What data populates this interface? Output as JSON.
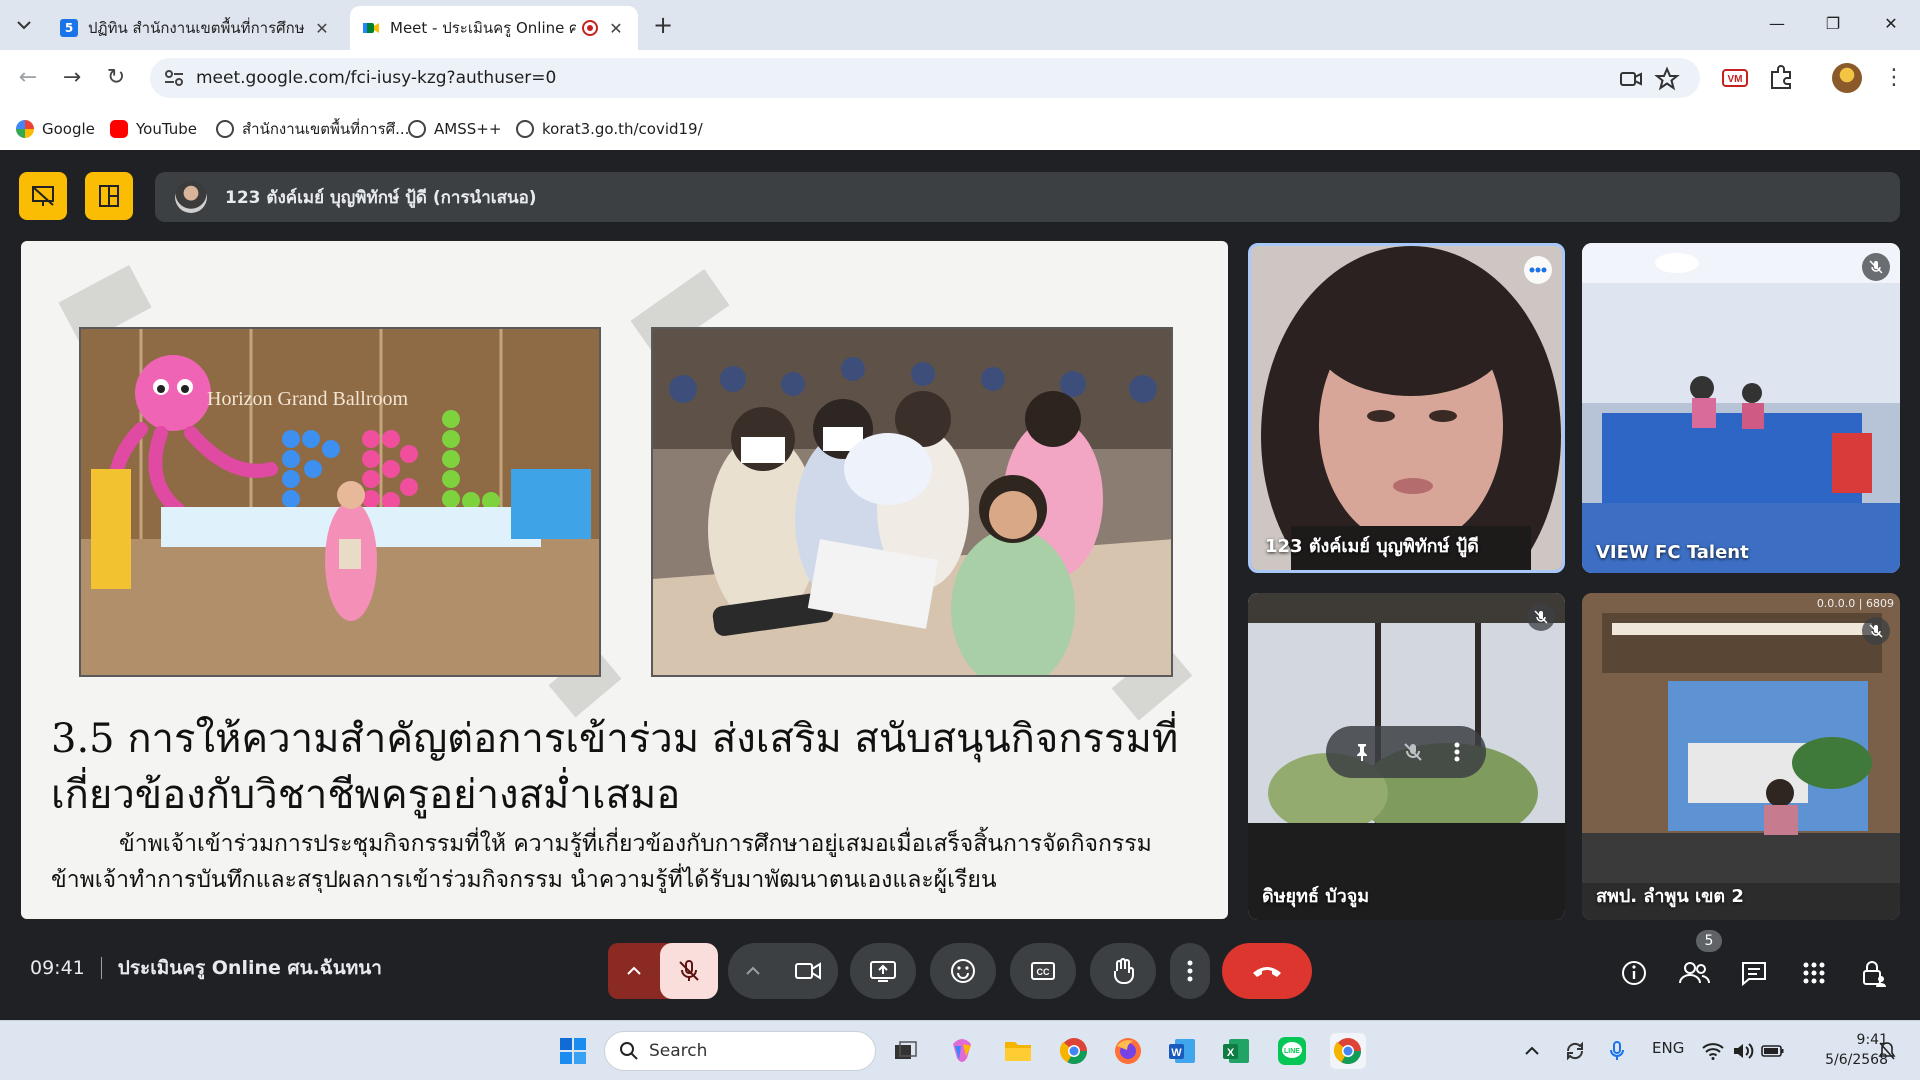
{
  "browser": {
    "tabs": [
      {
        "title": "ปฏิทิน สำนักงานเขตพื้นที่การศึกษาป",
        "active": false
      },
      {
        "title": "Meet - ประเมินครู Online ศน.",
        "active": true
      }
    ],
    "url": "meet.google.com/fci-iusy-kzg?authuser=0",
    "bookmarks": [
      {
        "label": "Google",
        "icon": "google-icon"
      },
      {
        "label": "YouTube",
        "icon": "youtube-icon"
      },
      {
        "label": "สำนักงานเขตพื้นที่การศึ...",
        "icon": "globe-icon"
      },
      {
        "label": "AMSS++",
        "icon": "globe-icon"
      },
      {
        "label": "korat3.go.th/covid19/",
        "icon": "globe-icon"
      }
    ]
  },
  "meet": {
    "presenter_label": "123 ตังค์เมย์ บุญพิทักษ์ ปู้ดี (การนำเสนอ)",
    "slide": {
      "photo1_text": "Horizon Grand Ballroom",
      "heading_line1": "3.5 การให้ความสำคัญต่อการเข้าร่วม ส่งเสริม สนับสนุนกิจกรรมที่",
      "heading_line2": "เกี่ยวข้องกับวิชาชีพครูอย่างสม่ำเสมอ",
      "body_line1": "ข้าพเจ้าเข้าร่วมการประชุมกิจกรรมที่ให้ ความรู้ที่เกี่ยวข้องกับการศึกษาอยู่เสมอเมื่อเสร็จสิ้นการจัดกิจกรรม",
      "body_line2": "ข้าพเจ้าทำการบันทึกและสรุปผลการเข้าร่วมกิจกรรม นำความรู้ที่ได้รับมาพัฒนาตนเองและผู้เรียน"
    },
    "participants": [
      {
        "name": "123 ตังค์เมย์ บุญพิทักษ์ ปู้ดี"
      },
      {
        "name": "VIEW FC Talent"
      },
      {
        "name": "ดิษยุทธ์ บัวจูม"
      },
      {
        "name": "สพป. ลำพูน เขต 2"
      }
    ],
    "tile4_overlay_text": "0.0.0.0 | 6809",
    "time": "09:41",
    "meeting_name": "ประเมินครู Online ศน.ฉันทนา",
    "people_count": "5"
  },
  "taskbar": {
    "search_label": "Search",
    "lang": "ENG",
    "time": "9:41",
    "date": "5/6/2568"
  },
  "colors": {
    "meet_bg": "#202124",
    "control_bg": "#3c4043",
    "end_call": "#dc362e",
    "highlight_yellow": "#fbbc04"
  }
}
